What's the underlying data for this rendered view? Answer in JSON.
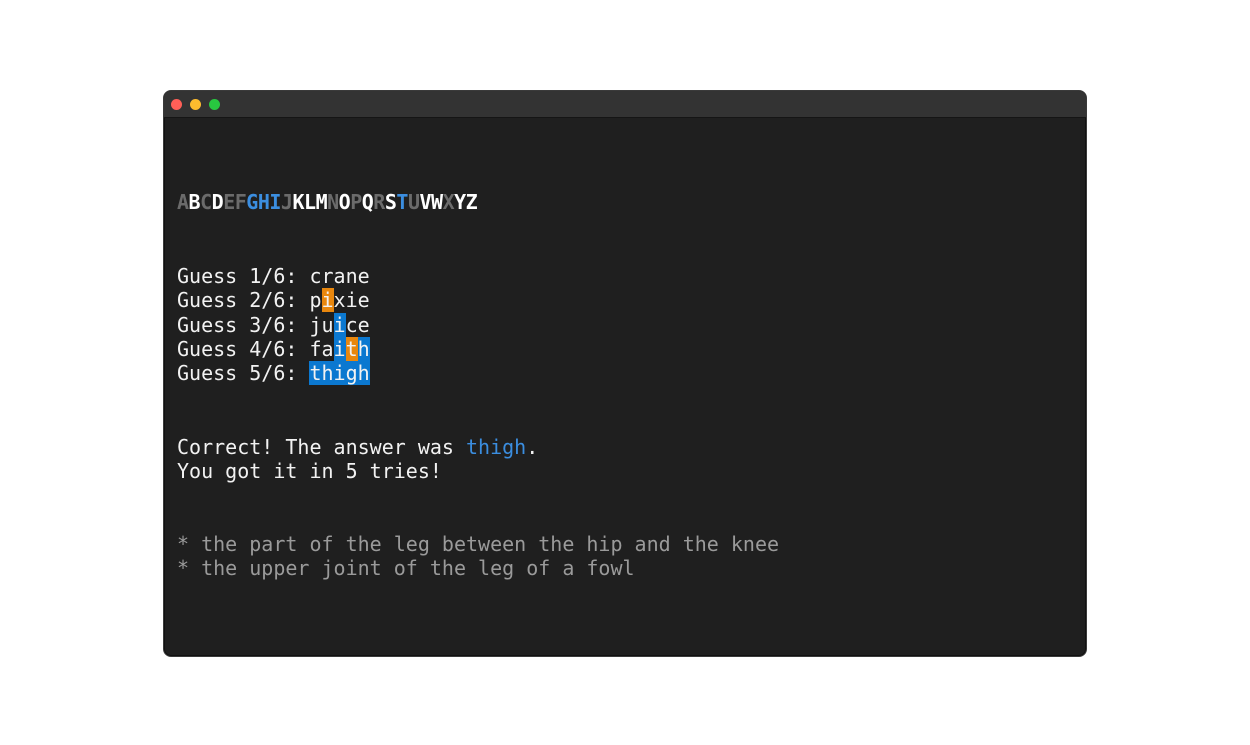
{
  "window": {
    "controls": {
      "close_color": "#ff5f57",
      "minimize_color": "#febc2e",
      "zoom_color": "#28c840"
    }
  },
  "colors": {
    "text": "#f2f2f2",
    "absent": "#6b6b6b",
    "present_in_word": "#ffffff",
    "correct_letter": "#3b8ee0",
    "misplaced_bg": "#e8870e",
    "correct_bg": "#0b78d0",
    "definition": "#9a9a9a"
  },
  "alphabet": [
    {
      "letter": "A",
      "state": "absent"
    },
    {
      "letter": "B",
      "state": "unused"
    },
    {
      "letter": "C",
      "state": "absent"
    },
    {
      "letter": "D",
      "state": "unused"
    },
    {
      "letter": "E",
      "state": "absent"
    },
    {
      "letter": "F",
      "state": "absent"
    },
    {
      "letter": "G",
      "state": "correct"
    },
    {
      "letter": "H",
      "state": "correct"
    },
    {
      "letter": "I",
      "state": "correct"
    },
    {
      "letter": "J",
      "state": "absent"
    },
    {
      "letter": "K",
      "state": "unused"
    },
    {
      "letter": "L",
      "state": "unused"
    },
    {
      "letter": "M",
      "state": "unused"
    },
    {
      "letter": "N",
      "state": "absent"
    },
    {
      "letter": "O",
      "state": "unused"
    },
    {
      "letter": "P",
      "state": "absent"
    },
    {
      "letter": "Q",
      "state": "unused"
    },
    {
      "letter": "R",
      "state": "absent"
    },
    {
      "letter": "S",
      "state": "unused"
    },
    {
      "letter": "T",
      "state": "correct"
    },
    {
      "letter": "U",
      "state": "absent"
    },
    {
      "letter": "V",
      "state": "unused"
    },
    {
      "letter": "W",
      "state": "unused"
    },
    {
      "letter": "X",
      "state": "absent"
    },
    {
      "letter": "Y",
      "state": "unused"
    },
    {
      "letter": "Z",
      "state": "unused"
    }
  ],
  "guesses": [
    {
      "prefix": "Guess 1/6: ",
      "letters": [
        {
          "ch": "c",
          "state": "none"
        },
        {
          "ch": "r",
          "state": "none"
        },
        {
          "ch": "a",
          "state": "none"
        },
        {
          "ch": "n",
          "state": "none"
        },
        {
          "ch": "e",
          "state": "none"
        }
      ]
    },
    {
      "prefix": "Guess 2/6: ",
      "letters": [
        {
          "ch": "p",
          "state": "none"
        },
        {
          "ch": "i",
          "state": "misplaced"
        },
        {
          "ch": "x",
          "state": "none"
        },
        {
          "ch": "i",
          "state": "none"
        },
        {
          "ch": "e",
          "state": "none"
        }
      ]
    },
    {
      "prefix": "Guess 3/6: ",
      "letters": [
        {
          "ch": "j",
          "state": "none"
        },
        {
          "ch": "u",
          "state": "none"
        },
        {
          "ch": "i",
          "state": "correct"
        },
        {
          "ch": "c",
          "state": "none"
        },
        {
          "ch": "e",
          "state": "none"
        }
      ]
    },
    {
      "prefix": "Guess 4/6: ",
      "letters": [
        {
          "ch": "f",
          "state": "none"
        },
        {
          "ch": "a",
          "state": "none"
        },
        {
          "ch": "i",
          "state": "correct"
        },
        {
          "ch": "t",
          "state": "misplaced"
        },
        {
          "ch": "h",
          "state": "correct"
        }
      ]
    },
    {
      "prefix": "Guess 5/6: ",
      "letters": [
        {
          "ch": "t",
          "state": "correct"
        },
        {
          "ch": "h",
          "state": "correct"
        },
        {
          "ch": "i",
          "state": "correct"
        },
        {
          "ch": "g",
          "state": "correct"
        },
        {
          "ch": "h",
          "state": "correct"
        }
      ]
    }
  ],
  "result": {
    "line1_prefix": "Correct! The answer was ",
    "answer": "thigh",
    "line1_suffix": ".",
    "line2": "You got it in 5 tries!"
  },
  "definitions": [
    "* the part of the leg between the hip and the knee",
    "* the upper joint of the leg of a fowl"
  ]
}
